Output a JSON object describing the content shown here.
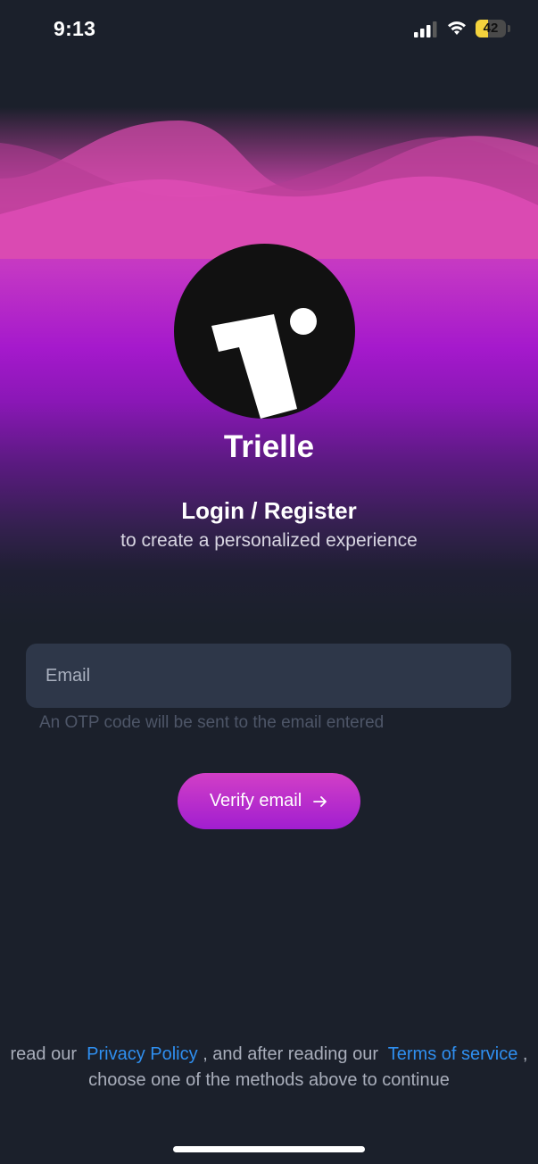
{
  "status_bar": {
    "time": "9:13",
    "battery_level": "42",
    "battery_fraction": 0.42,
    "icons": [
      "signal-icon",
      "wifi-icon",
      "battery-icon"
    ]
  },
  "brand": {
    "app_name": "Trielle",
    "logo_icon": "trielle-logo-icon"
  },
  "auth": {
    "title": "Login / Register",
    "subtitle": "to create a personalized experience",
    "email_placeholder": "Email",
    "email_value": "",
    "hint": "An OTP code will be sent to the email entered",
    "verify_label": "Verify email",
    "verify_icon": "arrow-right-icon"
  },
  "legal": {
    "prefix": "read our",
    "privacy_link": "Privacy Policy",
    "middle": ", and after reading our",
    "terms_link": "Terms of service",
    "suffix": ", choose one of the methods above to continue"
  },
  "colors": {
    "background": "#1b202b",
    "accent_pink": "#d847b4",
    "accent_purple": "#a519cc",
    "link": "#2f8ff0",
    "field_background": "#2e3749",
    "battery_yellow": "#f4d33d"
  }
}
